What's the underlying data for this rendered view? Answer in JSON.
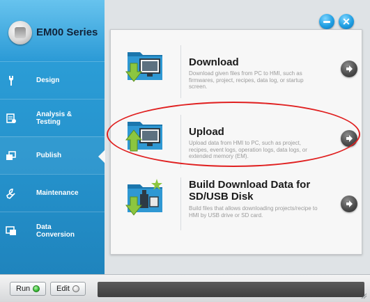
{
  "app": {
    "title": "EM00 Series"
  },
  "sidebar": {
    "items": [
      {
        "label": "Design",
        "icon": "design-icon"
      },
      {
        "label": "Analysis &\nTesting",
        "icon": "analysis-icon"
      },
      {
        "label": "Publish",
        "icon": "publish-icon",
        "active": true
      },
      {
        "label": "Maintenance",
        "icon": "maintenance-icon"
      },
      {
        "label": "Data\nConversion",
        "icon": "data-conversion-icon"
      }
    ]
  },
  "main": {
    "items": [
      {
        "title": "Download",
        "description": "Download given files from PC to HMI, such as firmwares, project, recipes, data log, or startup screen.",
        "icon": "download-folder-icon"
      },
      {
        "title": "Upload",
        "description": "Upload data from HMI to PC, such as project, recipes, event logs, operation logs, data logs, or extended memory (EM).",
        "icon": "upload-folder-icon",
        "highlighted": true
      },
      {
        "title": "Build Download Data for\nSD/USB Disk",
        "description": "Build files that allows downloading projects/recipe to HMI by USB drive or SD card.",
        "icon": "build-usb-folder-icon"
      }
    ]
  },
  "bottombar": {
    "run_label": "Run",
    "edit_label": "Edit"
  },
  "colors": {
    "sidebar": "#2592cc",
    "accent": "#1f9ee2",
    "highlight": "#e02020"
  }
}
